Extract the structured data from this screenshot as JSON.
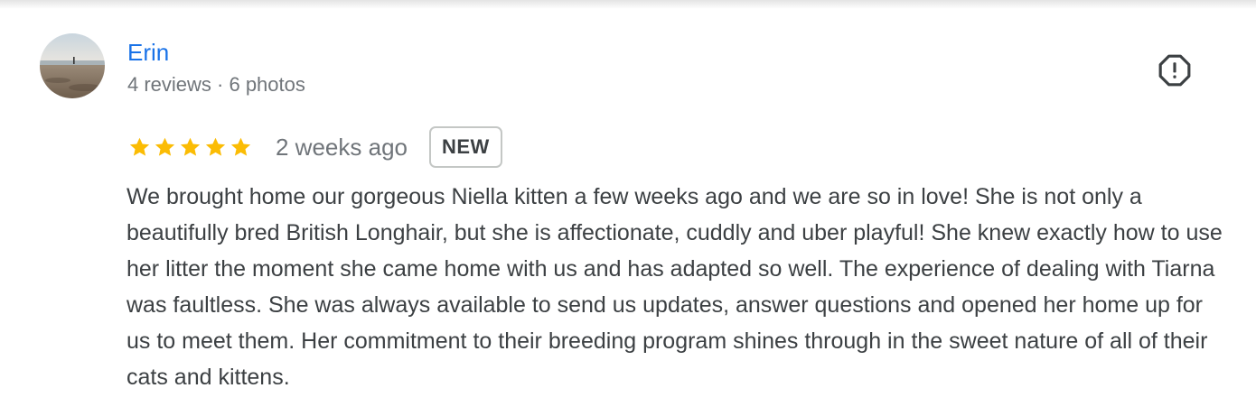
{
  "reviewer": {
    "name": "Erin",
    "meta": "4 reviews · 6 photos",
    "avatar": "beach-photo-avatar"
  },
  "report": {
    "icon": "report-flag-icon"
  },
  "review": {
    "rating": 5,
    "rating_max": 5,
    "time": "2 weeks ago",
    "badge": "NEW",
    "text": "We brought home our gorgeous Niella kitten a few weeks ago and we are so in love! She is not only a beautifully bred British Longhair, but she is affectionate, cuddly and uber playful! She knew exactly how to use her litter the moment she came home with us and has adapted so well. The experience of dealing with Tiarna was faultless. She was always available to send us updates, answer questions and opened her home up for us to meet them. Her commitment to their breeding program shines through in the sweet nature of all of their cats and kittens."
  },
  "colors": {
    "name_link": "#1a73e8",
    "secondary_text": "#70757a",
    "body_text": "#3c4043",
    "star": "#fbbc04",
    "badge_border": "#c4c7c5"
  }
}
